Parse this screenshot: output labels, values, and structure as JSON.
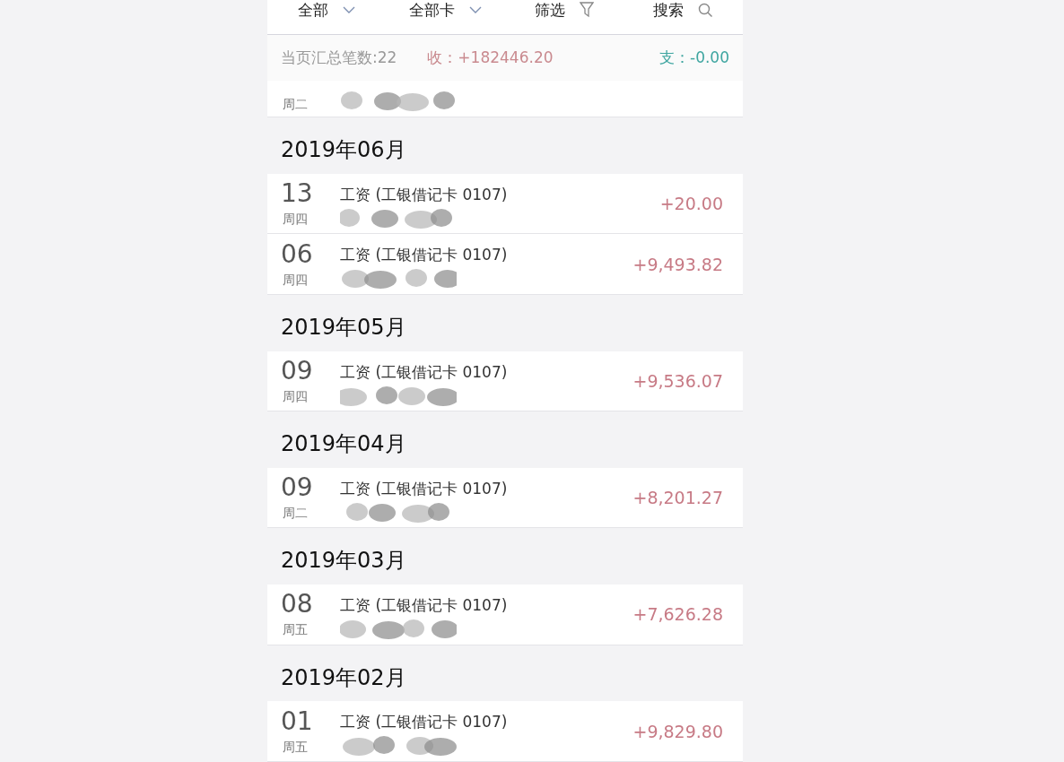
{
  "toolbar": [
    {
      "label": "全部",
      "kind": "dropdown"
    },
    {
      "label": "全部卡",
      "kind": "dropdown"
    },
    {
      "label": "筛选",
      "kind": "filter"
    },
    {
      "label": "搜索",
      "kind": "search"
    }
  ],
  "summary": {
    "count": "当页汇总笔数:22",
    "income_label": "收：",
    "income": "+182446.20",
    "expense_label": "支：",
    "expense": "-0.00"
  },
  "partial_row": {
    "weekday": "周二"
  },
  "months": [
    {
      "title": "2019年06月",
      "rows": [
        {
          "day": "13",
          "weekday": "周四",
          "title": "工资",
          "account": "(工银借记卡 0107)",
          "amount": "+20.00"
        },
        {
          "day": "06",
          "weekday": "周四",
          "title": "工资",
          "account": "(工银借记卡 0107)",
          "amount": "+9,493.82"
        }
      ]
    },
    {
      "title": "2019年05月",
      "rows": [
        {
          "day": "09",
          "weekday": "周四",
          "title": "工资",
          "account": "(工银借记卡 0107)",
          "amount": "+9,536.07"
        }
      ]
    },
    {
      "title": "2019年04月",
      "rows": [
        {
          "day": "09",
          "weekday": "周二",
          "title": "工资",
          "account": "(工银借记卡 0107)",
          "amount": "+8,201.27"
        }
      ]
    },
    {
      "title": "2019年03月",
      "rows": [
        {
          "day": "08",
          "weekday": "周五",
          "title": "工资",
          "account": "(工银借记卡 0107)",
          "amount": "+7,626.28"
        }
      ]
    },
    {
      "title": "2019年02月",
      "rows": [
        {
          "day": "01",
          "weekday": "周五",
          "title": "工资",
          "account": "(工银借记卡 0107)",
          "amount": "+9,829.80"
        }
      ]
    }
  ]
}
